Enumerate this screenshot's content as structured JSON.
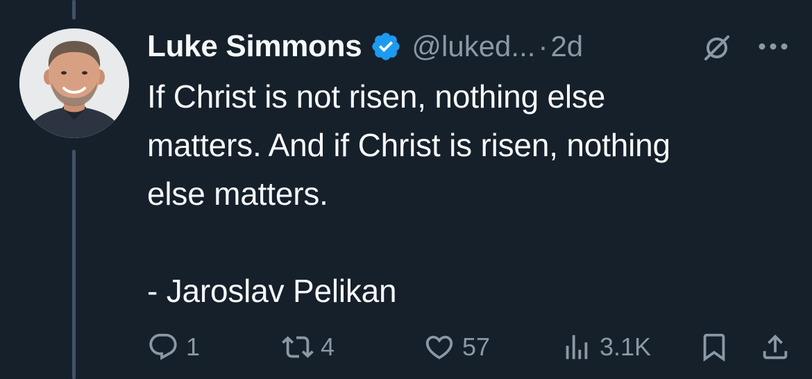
{
  "tweet": {
    "display_name": "Luke Simmons",
    "handle": "@luked...",
    "separator": "·",
    "time": "2d",
    "text_lines": [
      "If Christ is not risen, nothing else",
      "matters. And if Christ is risen, nothing",
      "else matters.",
      "- Jaroslav Pelikan"
    ],
    "verified": true
  },
  "actions": {
    "replies": "1",
    "reposts": "4",
    "likes": "57",
    "views": "3.1K"
  },
  "colors": {
    "background": "#15202b",
    "text_primary": "#f7f9f9",
    "text_secondary": "#8b98a5",
    "verified_badge": "#1d9bf0",
    "thread_line": "#425364"
  },
  "icons": {
    "verified": "verified-badge-icon",
    "grok": "grok-icon",
    "more": "more-icon",
    "reply": "reply-icon",
    "repost": "repost-icon",
    "like": "heart-icon",
    "views": "views-icon",
    "bookmark": "bookmark-icon",
    "share": "share-icon"
  }
}
